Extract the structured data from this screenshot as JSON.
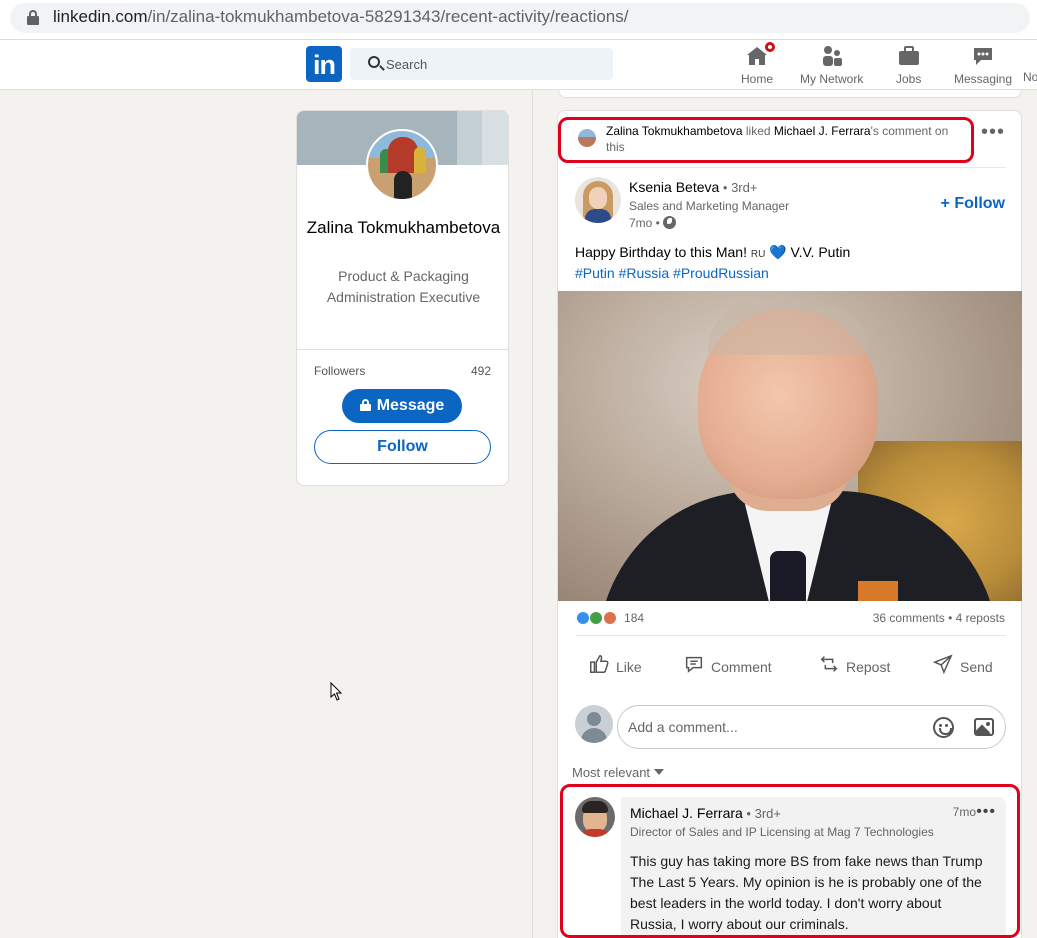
{
  "browser": {
    "url_host": "linkedin.com",
    "url_path": "/in/zalina-tokmukhambetova-58291343/recent-activity/reactions/"
  },
  "nav": {
    "logo": "in",
    "search_placeholder": "Search",
    "items": [
      {
        "label": "Home",
        "icon": "home-icon"
      },
      {
        "label": "My Network",
        "icon": "network-icon"
      },
      {
        "label": "Jobs",
        "icon": "briefcase-icon"
      },
      {
        "label": "Messaging",
        "icon": "messaging-icon"
      },
      {
        "label": "No",
        "icon": "bell-icon"
      }
    ]
  },
  "profile": {
    "name": "Zalina Tokmukhambetova",
    "headline": "Product & Packaging Administration Executive",
    "followers_label": "Followers",
    "followers_count": "492",
    "message_label": "Message",
    "follow_label": "Follow"
  },
  "post": {
    "context_actor": "Zalina Tokmukhambetova",
    "context_verb": " liked ",
    "context_target": "Michael J. Ferrara",
    "context_rest": "'s comment on this",
    "author_name": "Ksenia Beteva",
    "author_degree": " • 3rd+",
    "author_title": "Sales and Marketing Manager",
    "author_time": "7mo •",
    "follow_label": "+ Follow",
    "text_before": "Happy Birthday to this Man! ",
    "text_flag": "RU",
    "text_heart": "💙",
    "text_after": " V.V. Putin",
    "hashtags": "#Putin #Russia #ProudRussian",
    "reaction_count": "184",
    "stats": "36 comments • 4 reposts",
    "actions": {
      "like": "Like",
      "comment": "Comment",
      "repost": "Repost",
      "send": "Send"
    },
    "comment_placeholder": "Add a comment...",
    "sort_label": "Most relevant"
  },
  "comment": {
    "author_name": "Michael J. Ferrara",
    "author_degree": " • 3rd+",
    "author_title": "Director of Sales and IP Licensing at Mag 7 Technologies",
    "time": "7mo",
    "text": "This guy has taking more BS from fake news than Trump The Last 5 Years. My opinion is he is probably one of the best leaders in the world today. I don't worry about Russia, I worry about our criminals."
  },
  "colors": {
    "brand": "#0a66c2",
    "highlight": "#e0001b",
    "notification": "#cc1016"
  }
}
